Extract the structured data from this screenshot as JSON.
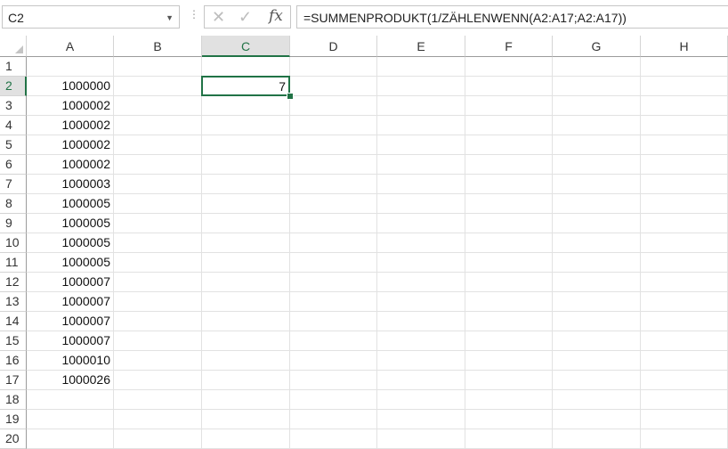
{
  "formula_bar": {
    "name_box": "C2",
    "cancel_symbol": "✕",
    "enter_symbol": "✓",
    "fx_label": "fx",
    "formula": "=SUMMENPRODUKT(1/ZÄHLENWENN(A2:A17;A2:A17))"
  },
  "columns": [
    "A",
    "B",
    "C",
    "D",
    "E",
    "F",
    "G",
    "H"
  ],
  "selected_column": "C",
  "selected_row": 2,
  "rows": [
    {
      "num": "1",
      "A": "",
      "C": ""
    },
    {
      "num": "2",
      "A": "1000000",
      "C": "7"
    },
    {
      "num": "3",
      "A": "1000002",
      "C": ""
    },
    {
      "num": "4",
      "A": "1000002",
      "C": ""
    },
    {
      "num": "5",
      "A": "1000002",
      "C": ""
    },
    {
      "num": "6",
      "A": "1000002",
      "C": ""
    },
    {
      "num": "7",
      "A": "1000003",
      "C": ""
    },
    {
      "num": "8",
      "A": "1000005",
      "C": ""
    },
    {
      "num": "9",
      "A": "1000005",
      "C": ""
    },
    {
      "num": "10",
      "A": "1000005",
      "C": ""
    },
    {
      "num": "11",
      "A": "1000005",
      "C": ""
    },
    {
      "num": "12",
      "A": "1000007",
      "C": ""
    },
    {
      "num": "13",
      "A": "1000007",
      "C": ""
    },
    {
      "num": "14",
      "A": "1000007",
      "C": ""
    },
    {
      "num": "15",
      "A": "1000007",
      "C": ""
    },
    {
      "num": "16",
      "A": "1000010",
      "C": ""
    },
    {
      "num": "17",
      "A": "1000026",
      "C": ""
    },
    {
      "num": "18",
      "A": "",
      "C": ""
    },
    {
      "num": "19",
      "A": "",
      "C": ""
    },
    {
      "num": "20",
      "A": "",
      "C": ""
    }
  ],
  "colors": {
    "accent": "#217346",
    "header_bg": "#e1e1e1",
    "gridline": "#e2e2e2"
  }
}
